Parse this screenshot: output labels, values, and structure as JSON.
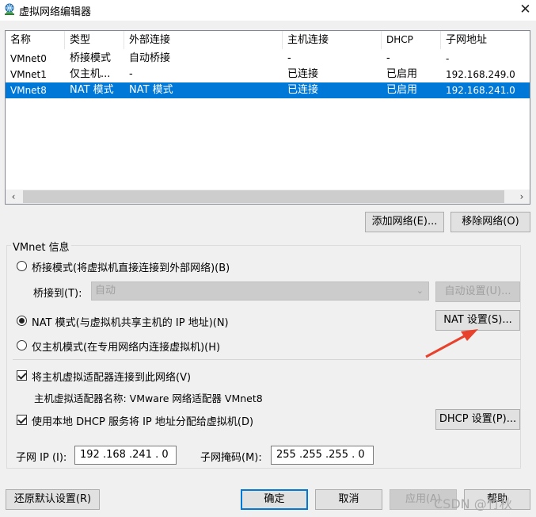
{
  "window": {
    "title": "虚拟网络编辑器",
    "close_label": "✕"
  },
  "table": {
    "columns": [
      "名称",
      "类型",
      "外部连接",
      "主机连接",
      "DHCP",
      "子网地址"
    ],
    "rows": [
      {
        "name": "VMnet0",
        "type": "桥接模式",
        "external": "自动桥接",
        "host": "-",
        "dhcp": "-",
        "subnet": "-"
      },
      {
        "name": "VMnet1",
        "type": "仅主机...",
        "external": "-",
        "host": "已连接",
        "dhcp": "已启用",
        "subnet": "192.168.249.0"
      },
      {
        "name": "VMnet8",
        "type": "NAT 模式",
        "external": "NAT 模式",
        "host": "已连接",
        "dhcp": "已启用",
        "subnet": "192.168.241.0"
      }
    ],
    "selected_row": 2
  },
  "buttons": {
    "add_network": "添加网络(E)...",
    "remove_network": "移除网络(O)",
    "auto_settings": "自动设置(U)...",
    "nat_settings": "NAT 设置(S)...",
    "dhcp_settings": "DHCP 设置(P)...",
    "restore_defaults": "还原默认设置(R)",
    "ok": "确定",
    "cancel": "取消",
    "apply": "应用(A)",
    "help": "帮助"
  },
  "vmnet_info": {
    "group_label": "VMnet 信息",
    "bridge_mode": "桥接模式(将虚拟机直接连接到外部网络)(B)",
    "bridge_to_label": "桥接到(T):",
    "bridge_to_value": "自动",
    "nat_mode": "NAT 模式(与虚拟机共享主机的 IP 地址)(N)",
    "host_only_mode": "仅主机模式(在专用网络内连接虚拟机)(H)",
    "selected_mode": "nat",
    "connect_host_adapter": "将主机虚拟适配器连接到此网络(V)",
    "host_adapter_name": "主机虚拟适配器名称: VMware 网络适配器 VMnet8",
    "use_local_dhcp": "使用本地 DHCP 服务将 IP 地址分配给虚拟机(D)",
    "subnet_ip_label": "子网 IP (I):",
    "subnet_ip": "192 .168 .241 . 0",
    "subnet_mask_label": "子网掩码(M):",
    "subnet_mask": "255 .255 .255 . 0"
  },
  "watermark": "CSDN @竹秋",
  "colors": {
    "selection": "#0078d7",
    "arrow": "#e8412c"
  }
}
